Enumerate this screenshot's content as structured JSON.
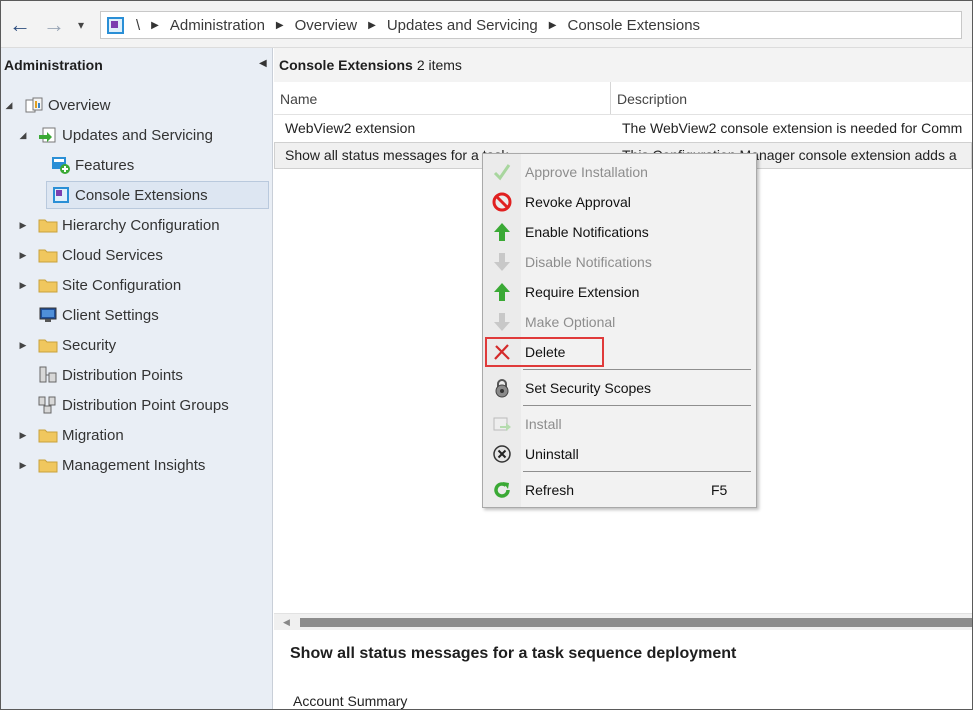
{
  "address_bar": {
    "back_label": "←",
    "forward_label": "→",
    "history_label": "▾",
    "root_label": "\\",
    "breadcrumb": [
      "Administration",
      "Overview",
      "Updates and Servicing",
      "Console Extensions"
    ]
  },
  "left_nav": {
    "title": "Administration",
    "items": [
      {
        "label": "Overview",
        "icon": "overview-icon",
        "level": 0,
        "expanded": true
      },
      {
        "label": "Updates and Servicing",
        "icon": "updates-icon",
        "level": 1,
        "expanded": true
      },
      {
        "label": "Features",
        "icon": "features-icon",
        "level": 2
      },
      {
        "label": "Console Extensions",
        "icon": "console-extensions-icon",
        "level": 2,
        "selected": true
      },
      {
        "label": "Hierarchy Configuration",
        "icon": "folder-icon",
        "level": 1
      },
      {
        "label": "Cloud Services",
        "icon": "folder-icon",
        "level": 1
      },
      {
        "label": "Site Configuration",
        "icon": "folder-icon",
        "level": 1
      },
      {
        "label": "Client Settings",
        "icon": "client-settings-icon",
        "level": 1
      },
      {
        "label": "Security",
        "icon": "folder-icon",
        "level": 1
      },
      {
        "label": "Distribution Points",
        "icon": "distribution-points-icon",
        "level": 1
      },
      {
        "label": "Distribution Point Groups",
        "icon": "distribution-point-groups-icon",
        "level": 1
      },
      {
        "label": "Migration",
        "icon": "folder-icon",
        "level": 1
      },
      {
        "label": "Management Insights",
        "icon": "folder-icon",
        "level": 1
      }
    ]
  },
  "list": {
    "title": "Console Extensions",
    "count_text": "2 items",
    "columns": [
      "Name",
      "Description"
    ],
    "rows": [
      {
        "name": "WebView2 extension",
        "description": "The WebView2 console extension is needed for Comm"
      },
      {
        "name": "Show all status messages for a task",
        "description": "This Configuration Manager console extension adds a"
      }
    ]
  },
  "details": {
    "title": "Show all status messages for a task sequence deployment",
    "section": "Account Summary"
  },
  "context_menu": {
    "items": [
      {
        "label": "Approve Installation",
        "icon": "checkmark-icon",
        "enabled": false
      },
      {
        "label": "Revoke Approval",
        "icon": "no-entry-icon",
        "enabled": true
      },
      {
        "label": "Enable Notifications",
        "icon": "green-up-arrow-icon",
        "enabled": true
      },
      {
        "label": "Disable Notifications",
        "icon": "gray-down-arrow-icon",
        "enabled": false
      },
      {
        "label": "Require Extension",
        "icon": "green-up-arrow-icon",
        "enabled": true
      },
      {
        "label": "Make Optional",
        "icon": "gray-down-arrow-icon",
        "enabled": false
      },
      {
        "label": "Delete",
        "icon": "red-x-icon",
        "enabled": true,
        "highlighted": true
      },
      {
        "label": "Set Security Scopes",
        "icon": "lock-icon",
        "enabled": true
      },
      {
        "label": "Install",
        "icon": "install-icon",
        "enabled": false
      },
      {
        "label": "Uninstall",
        "icon": "uninstall-icon",
        "enabled": true
      },
      {
        "label": "Refresh",
        "icon": "refresh-icon",
        "enabled": true,
        "shortcut": "F5"
      }
    ]
  },
  "colors": {
    "highlight_border": "#e03a3a",
    "nav_background": "#e9eef5",
    "folder": "#f0c75e",
    "green": "#3aa935"
  }
}
